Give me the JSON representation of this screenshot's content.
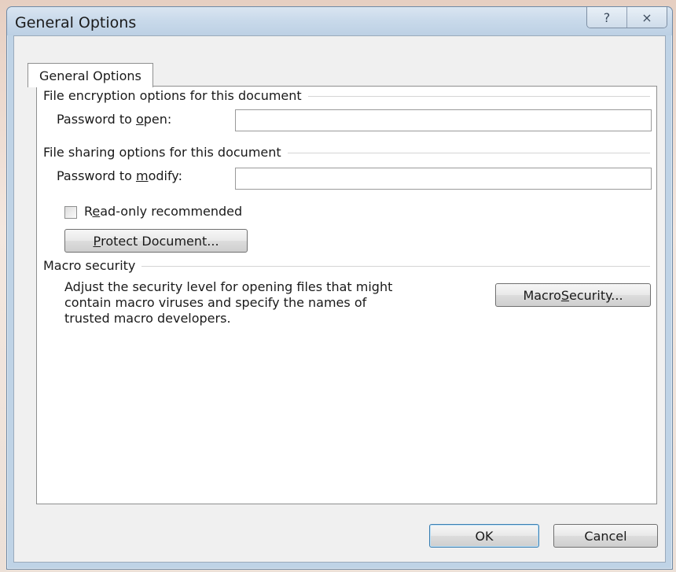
{
  "window": {
    "title": "General Options",
    "help_glyph": "?",
    "close_glyph": "⨯"
  },
  "tab": {
    "label": "General Options"
  },
  "encryption": {
    "group_title": "File encryption options for this document",
    "label_pre": "Password to ",
    "label_mnemonic": "o",
    "label_post": "pen:",
    "value": ""
  },
  "sharing": {
    "group_title": "File sharing options for this document",
    "label_pre": "Password to ",
    "label_mnemonic": "m",
    "label_post": "odify:",
    "value": "",
    "readonly_pre": "R",
    "readonly_mnemonic": "e",
    "readonly_post": "ad-only recommended",
    "protect_mnemonic": "P",
    "protect_post": "rotect Document..."
  },
  "macro": {
    "group_title": "Macro security",
    "desc_line1": "Adjust the security level for opening files that might",
    "desc_line2": "contain macro viruses and specify the names of",
    "desc_line3": "trusted macro developers.",
    "button_pre": "Macro ",
    "button_mnemonic": "S",
    "button_post": "ecurity..."
  },
  "footer": {
    "ok": "OK",
    "cancel": "Cancel"
  }
}
